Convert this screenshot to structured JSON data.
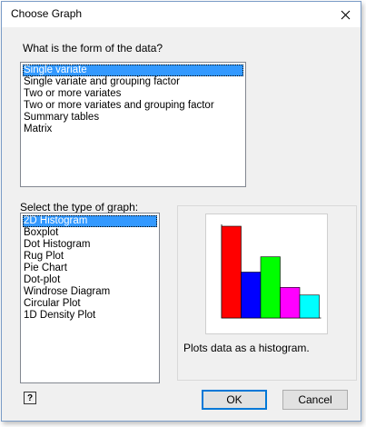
{
  "window": {
    "title": "Choose Graph"
  },
  "data_form": {
    "label": "What is the form of the data?",
    "options": [
      "Single variate",
      "Single variate and grouping factor",
      "Two or more variates",
      "Two or more variates and grouping factor",
      "Summary tables",
      "Matrix"
    ],
    "selected": "Single variate"
  },
  "graph_type": {
    "label": "Select the type of graph:",
    "options": [
      "2D Histogram",
      "Boxplot",
      "Dot Histogram",
      "Rug Plot",
      "Pie Chart",
      "Dot-plot",
      "Windrose Diagram",
      "Circular Plot",
      "1D Density Plot"
    ],
    "selected": "2D Histogram"
  },
  "preview": {
    "description": "Plots data as a histogram.",
    "bar_values": [
      6,
      3,
      4,
      2,
      1.5
    ],
    "bar_colors": [
      "#ff0000",
      "#0000ff",
      "#00ff00",
      "#ff00ff",
      "#00ffff"
    ]
  },
  "buttons": {
    "ok": "OK",
    "cancel": "Cancel",
    "help": "?"
  },
  "icons": {
    "close": "close-icon",
    "help": "help-icon"
  }
}
